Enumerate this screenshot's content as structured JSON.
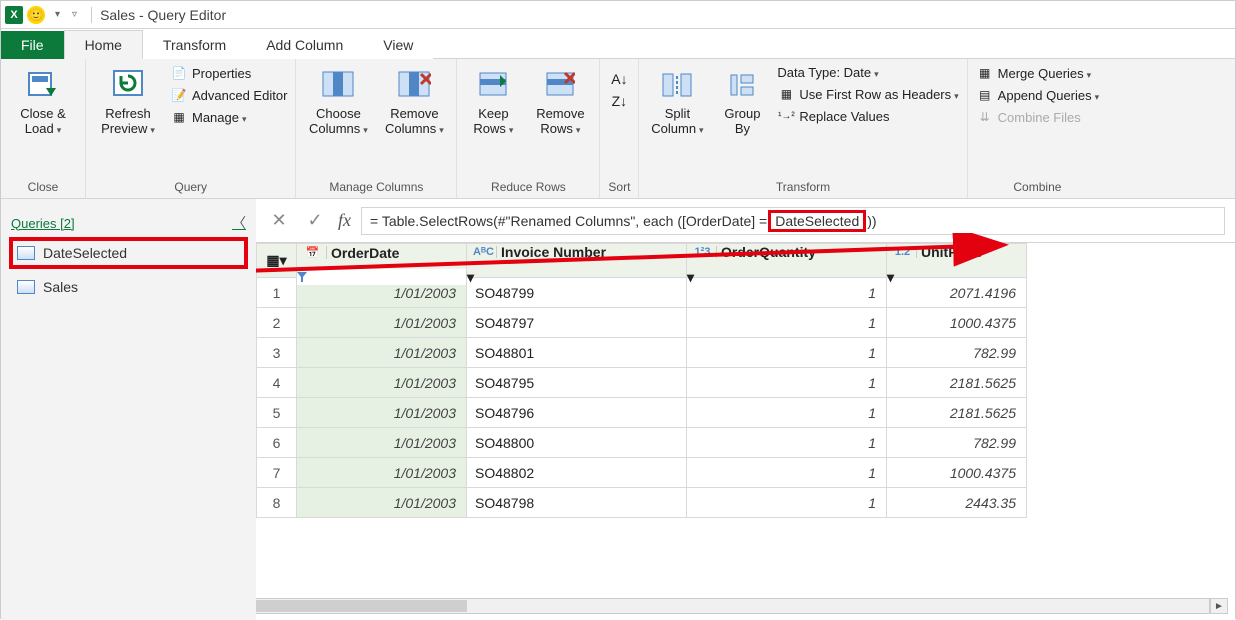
{
  "titlebar": {
    "excel_badge": "X",
    "title": "Sales - Query Editor"
  },
  "tabs": {
    "file": "File",
    "home": "Home",
    "transform": "Transform",
    "add_column": "Add Column",
    "view": "View"
  },
  "ribbon": {
    "close": {
      "label": "Close",
      "close_load": "Close &\nLoad"
    },
    "query": {
      "label": "Query",
      "refresh": "Refresh\nPreview",
      "properties": "Properties",
      "advanced": "Advanced Editor",
      "manage": "Manage"
    },
    "manage_cols": {
      "label": "Manage Columns",
      "choose": "Choose\nColumns",
      "remove": "Remove\nColumns"
    },
    "reduce_rows": {
      "label": "Reduce Rows",
      "keep": "Keep\nRows",
      "remove": "Remove\nRows"
    },
    "sort": {
      "label": "Sort"
    },
    "transform": {
      "label": "Transform",
      "split": "Split\nColumn",
      "groupby": "Group\nBy",
      "datatype": "Data Type: Date",
      "first_row": "Use First Row as Headers",
      "replace": "Replace Values"
    },
    "combine": {
      "label": "Combine",
      "merge": "Merge Queries",
      "append": "Append Queries",
      "combine_files": "Combine Files"
    }
  },
  "queries_panel": {
    "header": "Queries [2]",
    "items": [
      "DateSelected",
      "Sales"
    ]
  },
  "formula": {
    "prefix": "= Table.SelectRows(#\"Renamed Columns\", each ([OrderDate] = ",
    "highlight": "DateSelected",
    "suffix": "))"
  },
  "table": {
    "columns": [
      {
        "name": "OrderDate",
        "type_icon": "📅",
        "filtered": true
      },
      {
        "name": "Invoice Number",
        "type_icon": "AᴮC",
        "filtered": false
      },
      {
        "name": "OrderQuantity",
        "type_icon": "1²3",
        "filtered": false
      },
      {
        "name": "UnitPrice",
        "type_icon": "1.2",
        "filtered": false
      }
    ],
    "rows": [
      {
        "n": "1",
        "date": "1/01/2003",
        "inv": "SO48799",
        "qty": "1",
        "price": "2071.4196"
      },
      {
        "n": "2",
        "date": "1/01/2003",
        "inv": "SO48797",
        "qty": "1",
        "price": "1000.4375"
      },
      {
        "n": "3",
        "date": "1/01/2003",
        "inv": "SO48801",
        "qty": "1",
        "price": "782.99"
      },
      {
        "n": "4",
        "date": "1/01/2003",
        "inv": "SO48795",
        "qty": "1",
        "price": "2181.5625"
      },
      {
        "n": "5",
        "date": "1/01/2003",
        "inv": "SO48796",
        "qty": "1",
        "price": "2181.5625"
      },
      {
        "n": "6",
        "date": "1/01/2003",
        "inv": "SO48800",
        "qty": "1",
        "price": "782.99"
      },
      {
        "n": "7",
        "date": "1/01/2003",
        "inv": "SO48802",
        "qty": "1",
        "price": "1000.4375"
      },
      {
        "n": "8",
        "date": "1/01/2003",
        "inv": "SO48798",
        "qty": "1",
        "price": "2443.35"
      }
    ]
  }
}
